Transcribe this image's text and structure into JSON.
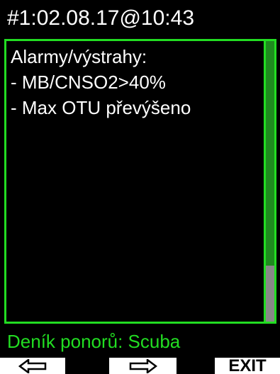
{
  "header": {
    "title": "#1:02.08.17@10:43"
  },
  "alerts": {
    "heading": "Alarmy/výstrahy:",
    "items": [
      "- MB/CNSO2>40%",
      "- Max OTU převýšeno"
    ]
  },
  "scroll": {
    "visible_fraction": 0.8
  },
  "footer": {
    "title": "Deník ponorů: Scuba"
  },
  "softkeys": {
    "left_icon": "arrow-left-icon",
    "right_icon": "arrow-right-icon",
    "exit_label": "EXIT"
  },
  "colors": {
    "accent": "#22dd22",
    "scroll_thumb": "#1f8a1f",
    "scroll_track": "#888888",
    "text": "#ffffff",
    "background": "#000000"
  }
}
